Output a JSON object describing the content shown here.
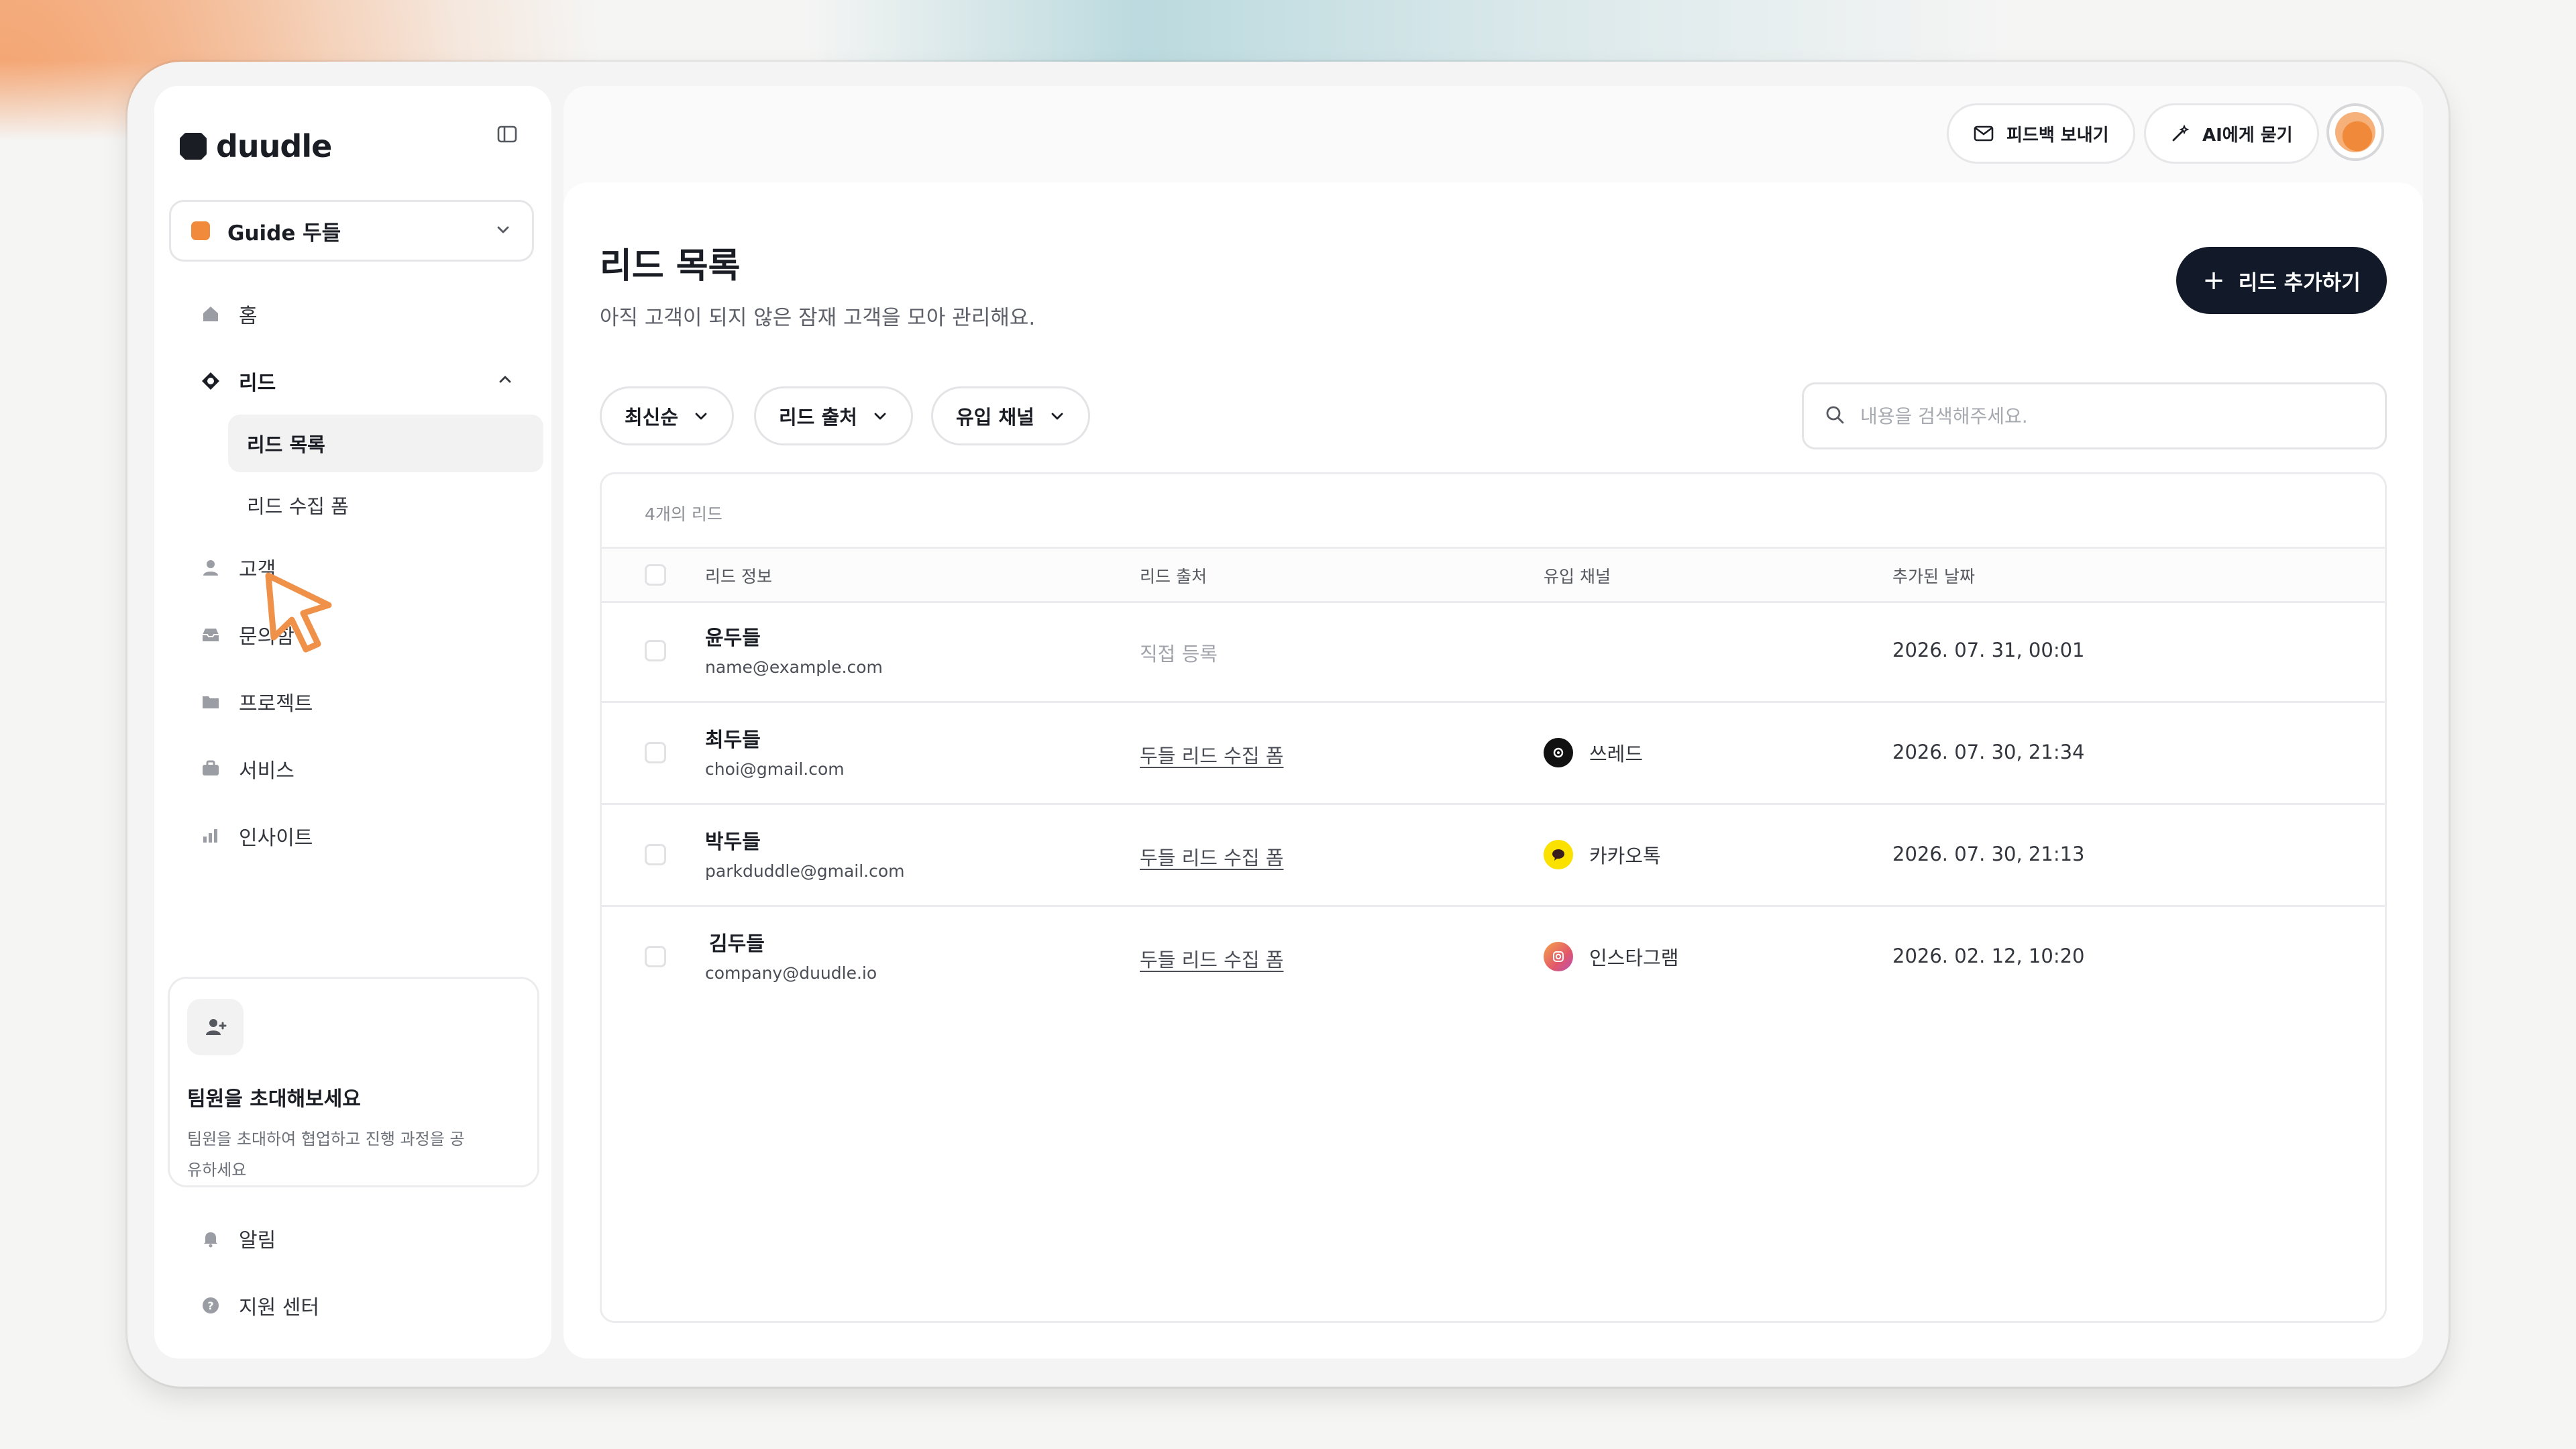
{
  "brand": {
    "name": "duudle"
  },
  "workspace": {
    "name": "Guide 두들"
  },
  "nav": {
    "home": "홈",
    "leads": "리드",
    "lead_list": "리드 목록",
    "lead_form": "리드 수집 폼",
    "customers": "고객",
    "inbox": "문의함",
    "projects": "프로젝트",
    "services": "서비스",
    "insights": "인사이트",
    "notifications": "알림",
    "support": "지원 센터"
  },
  "invite": {
    "title": "팀원을 초대해보세요",
    "desc": "팀원을 초대하여 협업하고 진행 과정을 공유하세요"
  },
  "topbar": {
    "feedback": "피드백 보내기",
    "ask_ai": "AI에게 묻기"
  },
  "page": {
    "title": "리드 목록",
    "desc": "아직 고객이 되지 않은 잠재 고객을 모아 관리해요.",
    "add_button": "리드 추가하기"
  },
  "filters": {
    "sort": "최신순",
    "source": "리드 출처",
    "channel": "유입 채널"
  },
  "search": {
    "placeholder": "내용을 검색해주세요."
  },
  "table": {
    "count_label": "4개의 리드",
    "headers": {
      "info": "리드 정보",
      "source": "리드 출처",
      "channel": "유입 채널",
      "date": "추가된 날짜"
    },
    "rows": [
      {
        "name": "윤두들",
        "email": "name@example.com",
        "source": "직접 등록",
        "channel": "",
        "date": "2026. 07. 31, 00:01"
      },
      {
        "name": "최두들",
        "email": "choi@gmail.com",
        "source": "두들 리드 수집 폼",
        "channel": "쓰레드",
        "channel_icon": "threads-icon",
        "date": "2026. 07. 30, 21:34"
      },
      {
        "name": "박두들",
        "email": "parkduddle@gmail.com",
        "source": "두들 리드 수집 폼",
        "channel": "카카오톡",
        "channel_icon": "kakaotalk-icon",
        "date": "2026. 07. 30, 21:13"
      },
      {
        "name": "김두들",
        "email": "company@duudle.io",
        "source": "두들 리드 수집 폼",
        "channel": "인스타그램",
        "channel_icon": "instagram-icon",
        "date": "2026. 02. 12, 10:20"
      }
    ]
  },
  "colors": {
    "primary_button": "#121a2a",
    "accent": "#f28a3c",
    "kakao": "#fae100"
  }
}
